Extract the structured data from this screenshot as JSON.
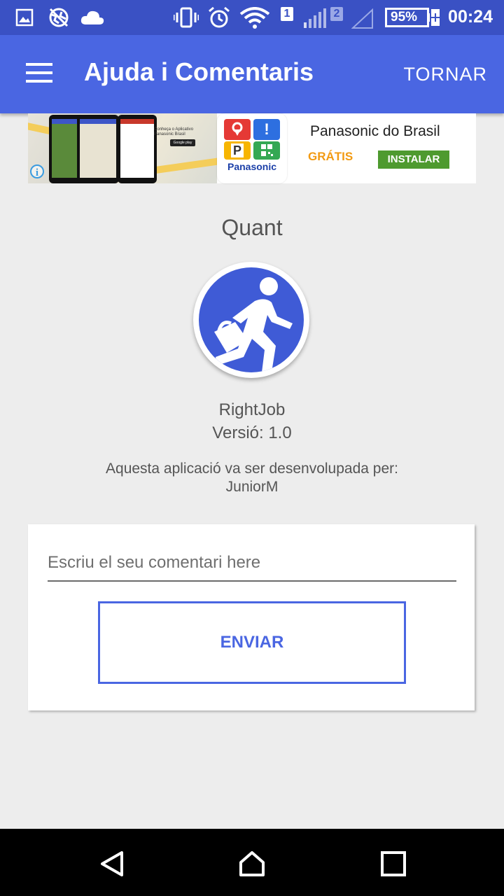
{
  "status_bar": {
    "battery_percent": "95%",
    "time": "00:24",
    "sim1": "1",
    "sim2": "2",
    "icons": [
      "image-icon",
      "vpn-globe-icon",
      "cloud-icon",
      "vibrate-icon",
      "alarm-icon",
      "wifi-icon",
      "signal-icon",
      "battery-icon"
    ]
  },
  "app_bar": {
    "title": "Ajuda i Comentaris",
    "back_label": "TORNAR",
    "menu_icon": "hamburger-menu-icon"
  },
  "ad": {
    "advertiser": "Panasonic do Brasil",
    "price": "GRÁTIS",
    "install_label": "INSTALAR",
    "logo_text": "Panasonic",
    "info_glyph": "i",
    "promo_lines": [
      "Conheça o Aplicativo",
      "Panasonic Brasil"
    ],
    "store_badge": "Google play"
  },
  "about": {
    "section_title": "Quant",
    "app_name": "RightJob",
    "version": "Versió: 1.0",
    "developed_by": "Aquesta aplicació va ser desenvolupada per:",
    "developer": "JuniorM"
  },
  "feedback": {
    "placeholder": "Escriu el seu comentari here",
    "value": "",
    "send_label": "ENVIAR"
  },
  "colors": {
    "primary": "#4a66e2",
    "status_bar": "#3a51c4",
    "background": "#ededed",
    "ad_install": "#4e9a2f",
    "ad_price": "#f29a12"
  }
}
